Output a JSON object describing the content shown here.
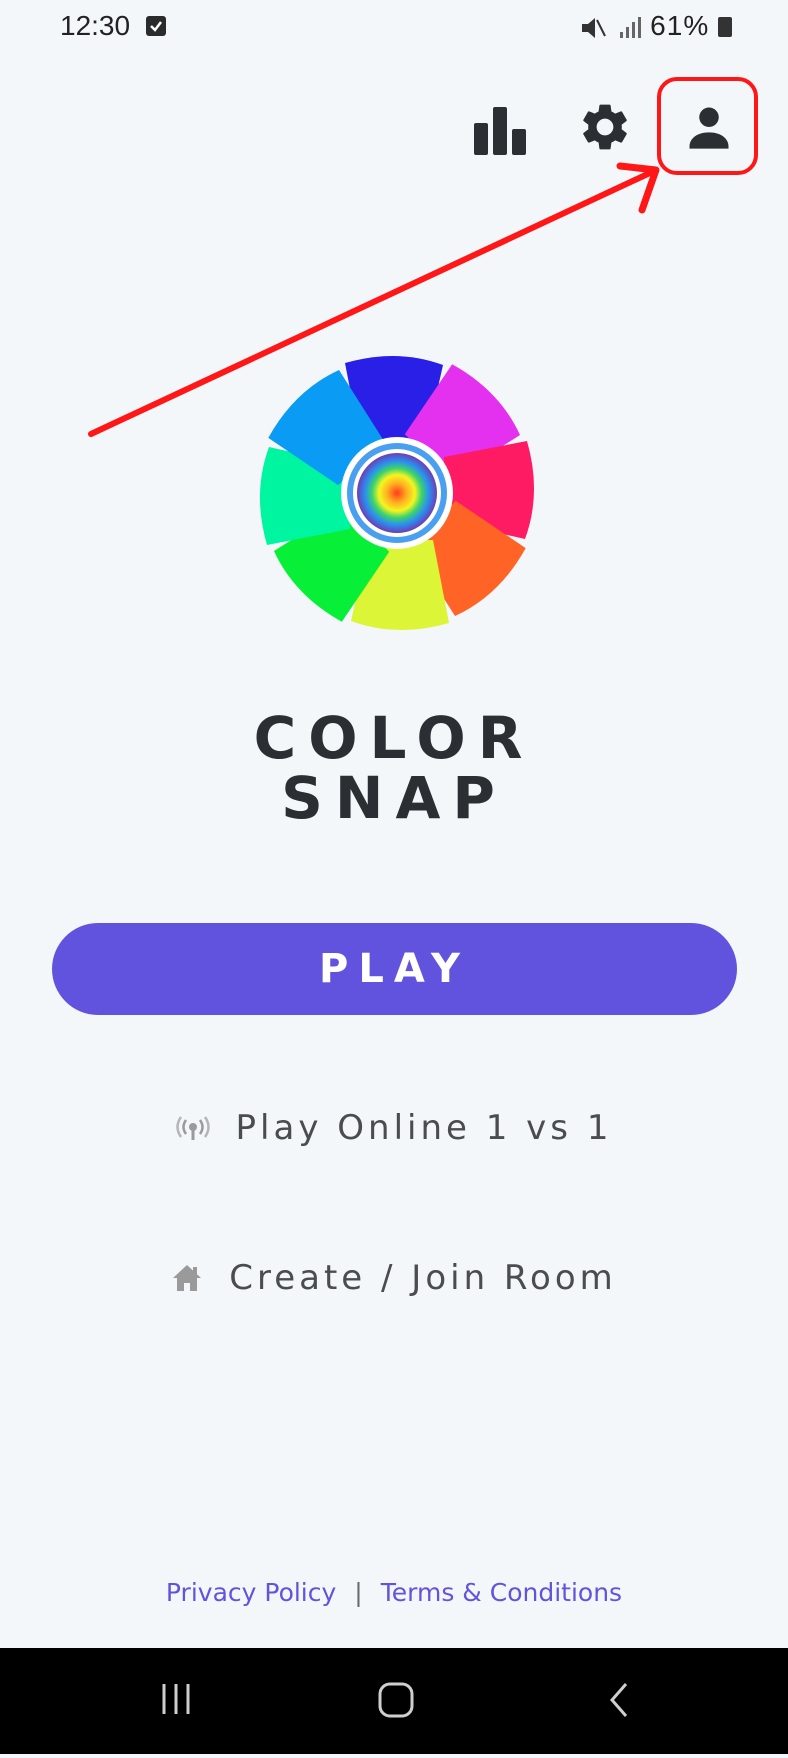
{
  "status_bar": {
    "time": "12:30",
    "battery": "61%"
  },
  "top_bar": {
    "icons": [
      "leaderboard-icon",
      "settings-icon",
      "profile-icon"
    ]
  },
  "annotation": {
    "highlight_color": "#ff1616",
    "target": "profile-icon"
  },
  "app": {
    "title_line1": "COLOR",
    "title_line2": "SNAP"
  },
  "main": {
    "play_label": "PLAY",
    "online_label": "Play Online 1 vs 1",
    "room_label": "Create / Join Room"
  },
  "footer": {
    "privacy_label": "Privacy Policy",
    "separator": "|",
    "terms_label": "Terms & Conditions"
  },
  "colors": {
    "accent": "#6253de",
    "background": "#f4f7f9",
    "text": "#2b2e33"
  }
}
